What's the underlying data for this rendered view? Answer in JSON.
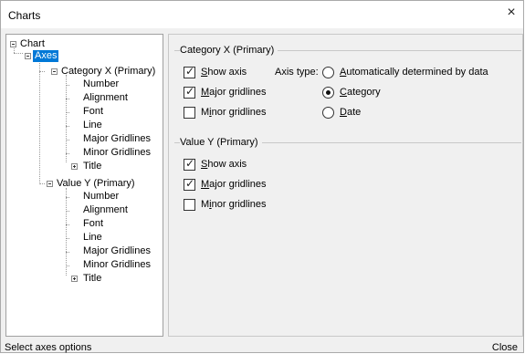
{
  "window": {
    "title": "Charts",
    "close_glyph": "×"
  },
  "tree": {
    "root": "Chart",
    "axes": "Axes",
    "category_axis": "Category X (Primary)",
    "value_axis": "Value Y (Primary)",
    "children": [
      "Number",
      "Alignment",
      "Font",
      "Line",
      "Major Gridlines",
      "Minor Gridlines",
      "Title"
    ]
  },
  "category_group": {
    "label": "Category X (Primary)",
    "show_axis": {
      "pre": "",
      "key": "S",
      "post": "how axis",
      "checked": true
    },
    "major_gridlines": {
      "pre": "",
      "key": "M",
      "post": "ajor gridlines",
      "checked": true
    },
    "minor_gridlines": {
      "pre": "M",
      "key": "i",
      "post": "nor gridlines",
      "checked": false
    },
    "axis_type_label": "Axis type:",
    "axis_types": [
      {
        "pre": "",
        "key": "A",
        "post": "utomatically determined by data",
        "selected": false
      },
      {
        "pre": "",
        "key": "C",
        "post": "ategory",
        "selected": true
      },
      {
        "pre": "",
        "key": "D",
        "post": "ate",
        "selected": false
      }
    ]
  },
  "value_group": {
    "label": "Value Y (Primary)",
    "show_axis": {
      "pre": "",
      "key": "S",
      "post": "how axis",
      "checked": true
    },
    "major_gridlines": {
      "pre": "",
      "key": "M",
      "post": "ajor gridlines",
      "checked": true
    },
    "minor_gridlines": {
      "pre": "M",
      "key": "i",
      "post": "nor gridlines",
      "checked": false
    }
  },
  "status": {
    "text": "Select axes options",
    "close_label": "Close"
  }
}
